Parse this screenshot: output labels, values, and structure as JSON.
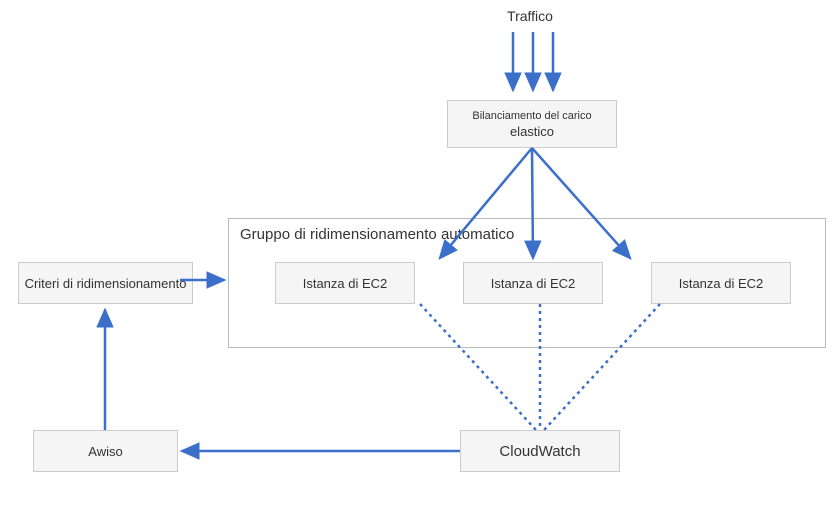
{
  "traffic_label": "Traffico",
  "load_balancer": {
    "line1": "Bilanciamento del carico",
    "line2": "elastico"
  },
  "asg_title": "Gruppo di ridimensionamento automatico",
  "ec2_instances": [
    {
      "label": "Istanza di EC2"
    },
    {
      "label": "Istanza di EC2"
    },
    {
      "label": "Istanza di EC2"
    }
  ],
  "scaling_policy": "Criteri di ridimensionamento",
  "alarm": "Awiso",
  "cloudwatch": "CloudWatch"
}
